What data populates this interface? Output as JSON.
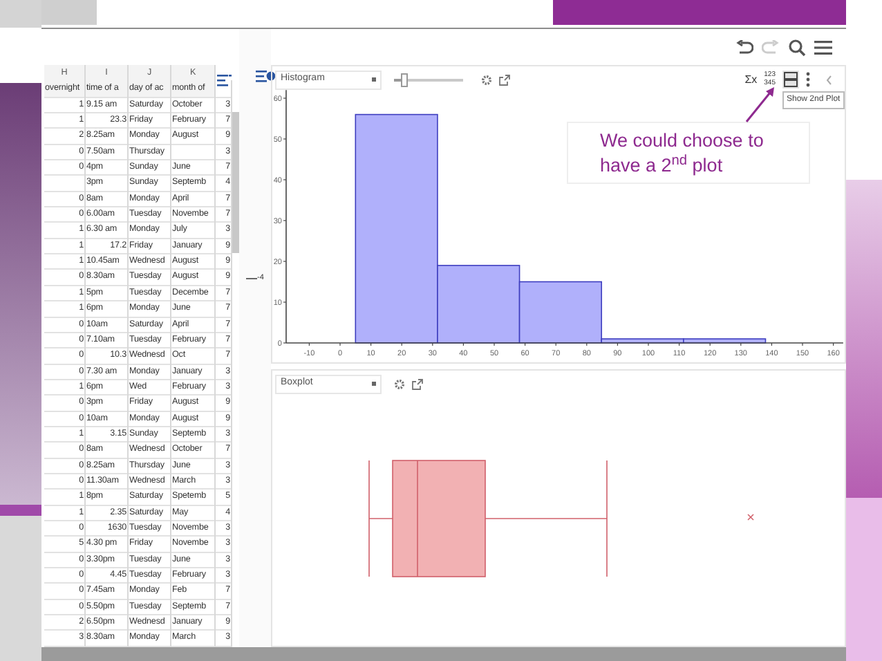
{
  "spreadsheet": {
    "column_letters": [
      "H",
      "I",
      "J",
      "K"
    ],
    "headers": [
      "overnight",
      "time of a",
      "day of ac",
      "month of"
    ],
    "rows": [
      {
        "cells": [
          "1",
          "9.15 am",
          "Saturday",
          "October",
          "3"
        ],
        "time_is_number": false
      },
      {
        "cells": [
          "1",
          "23.3",
          "Friday",
          "February",
          "7"
        ],
        "time_is_number": true
      },
      {
        "cells": [
          "2",
          "8.25am",
          "Monday",
          "August",
          "9"
        ],
        "time_is_number": false
      },
      {
        "cells": [
          "0",
          "7.50am",
          "Thursday",
          "",
          "3"
        ],
        "time_is_number": false
      },
      {
        "cells": [
          "0",
          "4pm",
          "Sunday",
          "June",
          "7"
        ],
        "time_is_number": false
      },
      {
        "cells": [
          "",
          "3pm",
          "Sunday",
          "Septemb",
          "4"
        ],
        "time_is_number": false
      },
      {
        "cells": [
          "0",
          "8am",
          "Monday",
          "April",
          "7"
        ],
        "time_is_number": false
      },
      {
        "cells": [
          "0",
          "6.00am",
          "Tuesday",
          "Novembe",
          "7"
        ],
        "time_is_number": false
      },
      {
        "cells": [
          "1",
          "6.30 am",
          "Monday",
          "July",
          "3"
        ],
        "time_is_number": false
      },
      {
        "cells": [
          "1",
          "17.2",
          "Friday",
          "January",
          "9"
        ],
        "time_is_number": true
      },
      {
        "cells": [
          "1",
          "10.45am",
          "Wednesd",
          "August",
          "9"
        ],
        "time_is_number": false
      },
      {
        "cells": [
          "0",
          "8.30am",
          "Tuesday",
          "August",
          "9"
        ],
        "time_is_number": false
      },
      {
        "cells": [
          "1",
          "5pm",
          "Tuesday",
          "Decembe",
          "7"
        ],
        "time_is_number": false
      },
      {
        "cells": [
          "1",
          "6pm",
          "Monday",
          "June",
          "7"
        ],
        "time_is_number": false
      },
      {
        "cells": [
          "0",
          "10am",
          "Saturday",
          "April",
          "7"
        ],
        "time_is_number": false
      },
      {
        "cells": [
          "0",
          "7.10am",
          "Tuesday",
          "February",
          "7"
        ],
        "time_is_number": false
      },
      {
        "cells": [
          "0",
          "10.3",
          "Wednesd",
          "Oct",
          "7"
        ],
        "time_is_number": true
      },
      {
        "cells": [
          "0",
          "7.30 am",
          "Monday",
          "January",
          "3"
        ],
        "time_is_number": false
      },
      {
        "cells": [
          "1",
          "6pm",
          "Wed",
          "February",
          "3"
        ],
        "time_is_number": false
      },
      {
        "cells": [
          "0",
          "3pm",
          "Friday",
          "August",
          "9"
        ],
        "time_is_number": false
      },
      {
        "cells": [
          "0",
          "10am",
          "Monday",
          "August",
          "9"
        ],
        "time_is_number": false
      },
      {
        "cells": [
          "1",
          "3.15",
          "Sunday",
          "Septemb",
          "3"
        ],
        "time_is_number": true
      },
      {
        "cells": [
          "0",
          "8am",
          "Wednesd",
          "October",
          "7"
        ],
        "time_is_number": false
      },
      {
        "cells": [
          "0",
          "8.25am",
          "Thursday",
          "June",
          "3"
        ],
        "time_is_number": false
      },
      {
        "cells": [
          "0",
          "11.30am",
          "Wednesd",
          "March",
          "3"
        ],
        "time_is_number": false
      },
      {
        "cells": [
          "1",
          "8pm",
          "Saturday",
          "Spetemb",
          "5"
        ],
        "time_is_number": false
      },
      {
        "cells": [
          "1",
          "2.35",
          "Saturday",
          "May",
          "4"
        ],
        "time_is_number": true
      },
      {
        "cells": [
          "0",
          "1630",
          "Tuesday",
          "Novembe",
          "3"
        ],
        "time_is_number": true
      },
      {
        "cells": [
          "5",
          "4.30 pm",
          "Friday",
          "Novembe",
          "3"
        ],
        "time_is_number": false
      },
      {
        "cells": [
          "0",
          "3.30pm",
          "Tuesday",
          "June",
          "3"
        ],
        "time_is_number": false
      },
      {
        "cells": [
          "0",
          "4.45",
          "Tuesday",
          "February",
          "3"
        ],
        "time_is_number": true
      },
      {
        "cells": [
          "0",
          "7.45am",
          "Monday",
          "Feb",
          "7"
        ],
        "time_is_number": false
      },
      {
        "cells": [
          "0",
          "5.50pm",
          "Tuesday",
          "Septemb",
          "7"
        ],
        "time_is_number": false
      },
      {
        "cells": [
          "2",
          "6.50pm",
          "Wednesd",
          "January",
          "9"
        ],
        "time_is_number": false
      },
      {
        "cells": [
          "3",
          "8.30am",
          "Monday",
          "March",
          "3"
        ],
        "time_is_number": false
      }
    ]
  },
  "divider_label": "-4",
  "histogram_panel": {
    "plot_type": "Histogram",
    "slider": {
      "level": 0.14
    },
    "stats_label": "Σx",
    "table_label": [
      "123",
      "345"
    ],
    "chart_data": {
      "type": "bar",
      "x": [
        18.3,
        44.9,
        71.5,
        98.1,
        124.7
      ],
      "values": [
        56,
        19,
        15,
        1,
        1
      ],
      "xlim": [
        -17.5,
        163.2
      ],
      "ylim": [
        0,
        62
      ],
      "xticks": [
        -10,
        0,
        10,
        20,
        30,
        40,
        50,
        60,
        70,
        80,
        90,
        100,
        110,
        120,
        130,
        140,
        150,
        160
      ],
      "yticks": [
        0,
        10,
        20,
        30,
        40,
        50,
        60
      ]
    }
  },
  "tooltip": "Show 2nd Plot",
  "callout": "We could choose to have a 2$^{nd}$ plot",
  "boxplot_panel": {
    "plot_type": "Boxplot"
  }
}
